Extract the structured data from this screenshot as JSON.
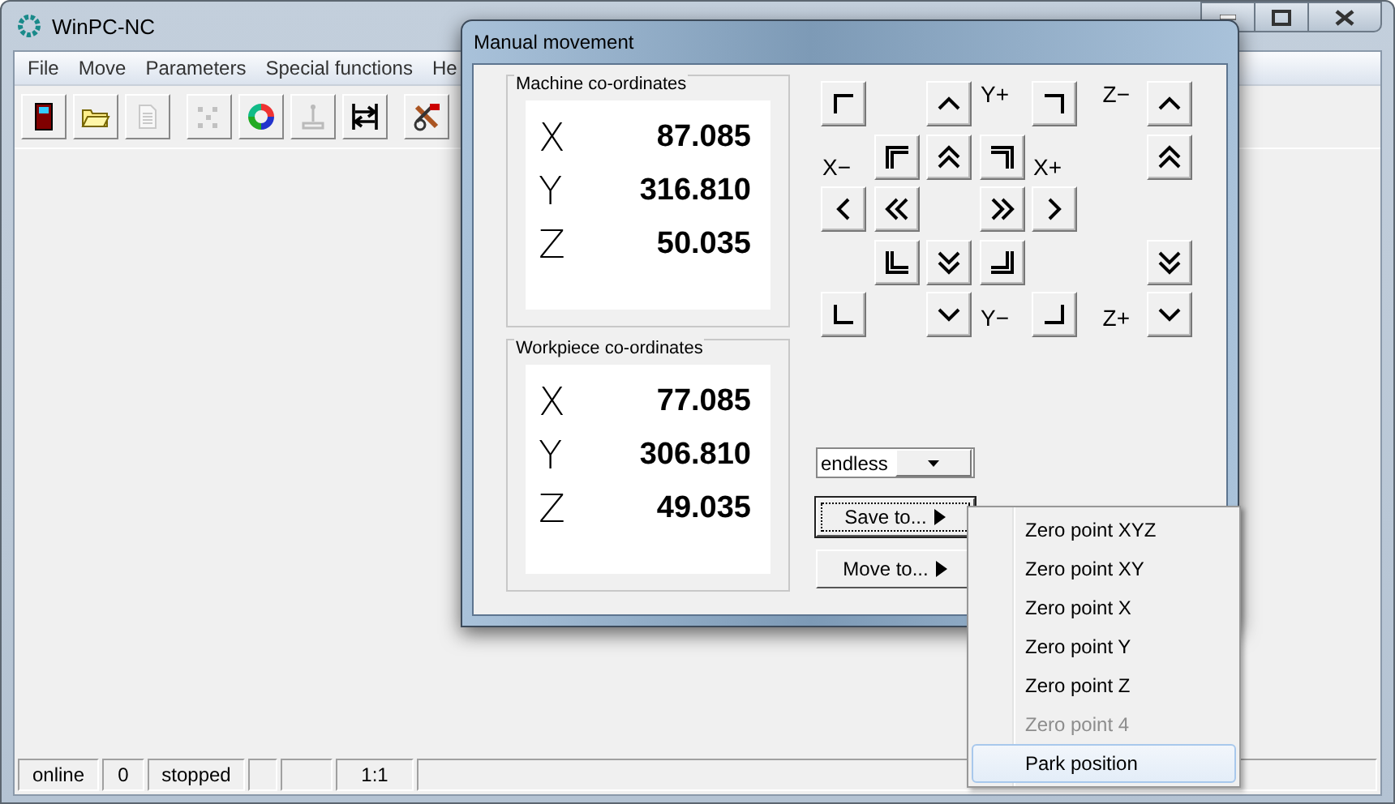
{
  "window": {
    "title": "WinPC-NC"
  },
  "menu": [
    "File",
    "Move",
    "Parameters",
    "Special functions",
    "He"
  ],
  "toolbar": [
    {
      "disabled": false
    },
    {
      "disabled": false
    },
    {
      "disabled": true
    },
    {
      "disabled": true
    },
    {
      "disabled": false
    },
    {
      "disabled": true
    },
    {
      "disabled": false
    },
    {
      "disabled": false
    }
  ],
  "status_bar": [
    {
      "kind": "text",
      "text": "online"
    },
    {
      "kind": "text",
      "text": "0"
    },
    {
      "kind": "text",
      "text": "stopped"
    },
    {
      "kind": "blank"
    },
    {
      "kind": "blank"
    },
    {
      "kind": "text",
      "text": "1:1"
    },
    {
      "kind": "blank"
    }
  ],
  "dialog": {
    "title": "Manual movement",
    "machine": {
      "title": "Machine co-ordinates",
      "axes": [
        {
          "axis": "X",
          "value": "87.085"
        },
        {
          "axis": "Y",
          "value": "316.810"
        },
        {
          "axis": "Z",
          "value": "50.035"
        }
      ]
    },
    "workpiece": {
      "title": "Workpiece co-ordinates",
      "axes": [
        {
          "axis": "X",
          "value": "77.085"
        },
        {
          "axis": "Y",
          "value": "306.810"
        },
        {
          "axis": "Z",
          "value": "49.035"
        }
      ]
    },
    "jog_pad": [
      [
        {
          "kind": "button"
        },
        {
          "kind": "empty"
        },
        {
          "kind": "button"
        },
        {
          "kind": "label",
          "text": "Y+"
        },
        {
          "kind": "button"
        },
        {
          "kind": "label",
          "text": "Z−"
        },
        {
          "kind": "button"
        }
      ],
      [
        {
          "kind": "label",
          "text": "X−"
        },
        {
          "kind": "button"
        },
        {
          "kind": "button"
        },
        {
          "kind": "button"
        },
        {
          "kind": "label",
          "text": "X+"
        },
        {
          "kind": "empty"
        },
        {
          "kind": "button"
        }
      ],
      [
        {
          "kind": "button"
        },
        {
          "kind": "button"
        },
        {
          "kind": "empty"
        },
        {
          "kind": "button"
        },
        {
          "kind": "button"
        },
        {
          "kind": "empty"
        },
        {
          "kind": "empty"
        }
      ],
      [
        {
          "kind": "empty"
        },
        {
          "kind": "button"
        },
        {
          "kind": "button"
        },
        {
          "kind": "button"
        },
        {
          "kind": "empty"
        },
        {
          "kind": "empty"
        },
        {
          "kind": "button"
        }
      ],
      [
        {
          "kind": "button"
        },
        {
          "kind": "empty"
        },
        {
          "kind": "button"
        },
        {
          "kind": "label",
          "text": "Y−"
        },
        {
          "kind": "button"
        },
        {
          "kind": "label",
          "text": "Z+"
        },
        {
          "kind": "button"
        }
      ]
    ],
    "mode_select": {
      "value": "endless"
    },
    "buttons": [
      {
        "label": "Save to...",
        "focused": true
      },
      {
        "label": "Move to...",
        "focused": false
      }
    ]
  },
  "popup_menu": [
    {
      "label": "Zero point XYZ",
      "disabled": false,
      "selected": false
    },
    {
      "label": "Zero point XY",
      "disabled": false,
      "selected": false
    },
    {
      "label": "Zero point X",
      "disabled": false,
      "selected": false
    },
    {
      "label": "Zero point Y",
      "disabled": false,
      "selected": false
    },
    {
      "label": "Zero point Z",
      "disabled": false,
      "selected": false
    },
    {
      "label": "Zero point 4",
      "disabled": true,
      "selected": false
    },
    {
      "label": "Park position",
      "disabled": false,
      "selected": true
    }
  ]
}
